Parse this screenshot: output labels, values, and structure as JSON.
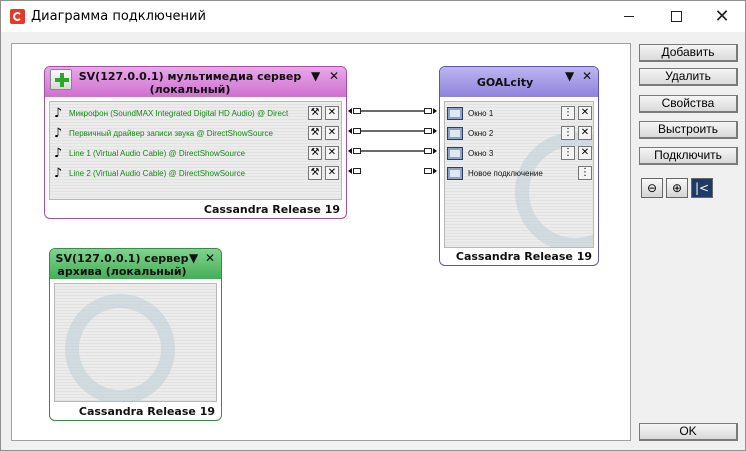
{
  "window": {
    "title": "Диаграмма подключений",
    "icons": {
      "app": "app-logo-icon",
      "minimize": "minimize-icon",
      "maximize": "maximize-icon",
      "close": "close-icon"
    }
  },
  "colors": {
    "multimedia_header": "#d97fd9",
    "goal_header": "#9a8fe0",
    "archive_header": "#4fb866",
    "label_green": "#138a13"
  },
  "nodes": {
    "multimedia": {
      "title": "SV(127.0.0.1) мультимедиа сервер (локальный)",
      "footer": "Cassandra Release  19",
      "rows": [
        {
          "label": "Микрофон (SoundMAX Integrated Digital HD Audio) @ Direct"
        },
        {
          "label": "Первичный драйвер записи звука @ DirectShowSource"
        },
        {
          "label": "Line 1 (Virtual Audio Cable) @ DirectShowSource"
        },
        {
          "label": "Line 2 (Virtual Audio Cable) @ DirectShowSource"
        }
      ]
    },
    "goal": {
      "title": "GOALcity",
      "footer": "Cassandra Release  19",
      "rows": [
        {
          "label": "Окно 1"
        },
        {
          "label": "Окно 2"
        },
        {
          "label": "Окно 3"
        },
        {
          "label": "Новое подключение"
        }
      ]
    },
    "archive": {
      "title": "SV(127.0.0.1) сервер архива (локальный)",
      "footer": "Cassandra Release  19"
    }
  },
  "sidebar": {
    "add": "Добавить",
    "delete": "Удалить",
    "properties": "Свойства",
    "arrange": "Выстроить",
    "connect": "Подключить",
    "ok": "OK"
  },
  "glyphs": {
    "collapse": "▼",
    "close": "✕",
    "note": "♪",
    "wrench": "🔧",
    "x": "✕",
    "zoom_out": "⊖",
    "zoom_in": "⊕",
    "fit": "|<"
  }
}
